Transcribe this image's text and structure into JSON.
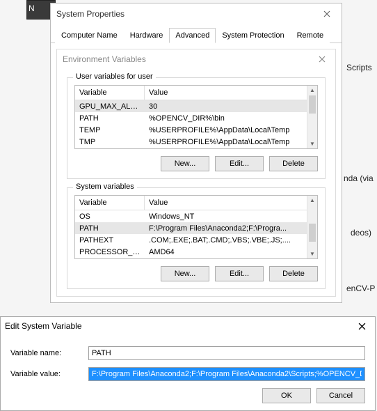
{
  "background": {
    "frag1": "Scripts",
    "frag2": "nda (via",
    "frag3": "deos)",
    "frag4": "enCV-P",
    "n_char": "N"
  },
  "sysProps": {
    "title": "System Properties",
    "tabs": [
      "Computer Name",
      "Hardware",
      "Advanced",
      "System Protection",
      "Remote"
    ],
    "activeTab": 2
  },
  "envVars": {
    "title": "Environment Variables",
    "userGroupLabel": "User variables for user",
    "systemGroupLabel": "System variables",
    "headers": {
      "variable": "Variable",
      "value": "Value"
    },
    "userRows": [
      {
        "variable": "GPU_MAX_ALLO...",
        "value": "30"
      },
      {
        "variable": "PATH",
        "value": "%OPENCV_DIR%\\bin"
      },
      {
        "variable": "TEMP",
        "value": "%USERPROFILE%\\AppData\\Local\\Temp"
      },
      {
        "variable": "TMP",
        "value": "%USERPROFILE%\\AppData\\Local\\Temp"
      }
    ],
    "systemRows": [
      {
        "variable": "OS",
        "value": "Windows_NT"
      },
      {
        "variable": "PATH",
        "value": "F:\\Program Files\\Anaconda2;F:\\Progra..."
      },
      {
        "variable": "PATHEXT",
        "value": ".COM;.EXE;.BAT;.CMD;.VBS;.VBE;.JS;...."
      },
      {
        "variable": "PROCESSOR_A...",
        "value": "AMD64"
      }
    ],
    "buttons": {
      "new": "New...",
      "edit": "Edit...",
      "delete": "Delete"
    }
  },
  "editSysVar": {
    "title": "Edit System Variable",
    "nameLabel": "Variable name:",
    "valueLabel": "Variable value:",
    "nameValue": "PATH",
    "valueValue": "F:\\Program Files\\Anaconda2;F:\\Program Files\\Anaconda2\\Scripts;%OPENCV_DIR%\\bin",
    "ok": "OK",
    "cancel": "Cancel"
  }
}
